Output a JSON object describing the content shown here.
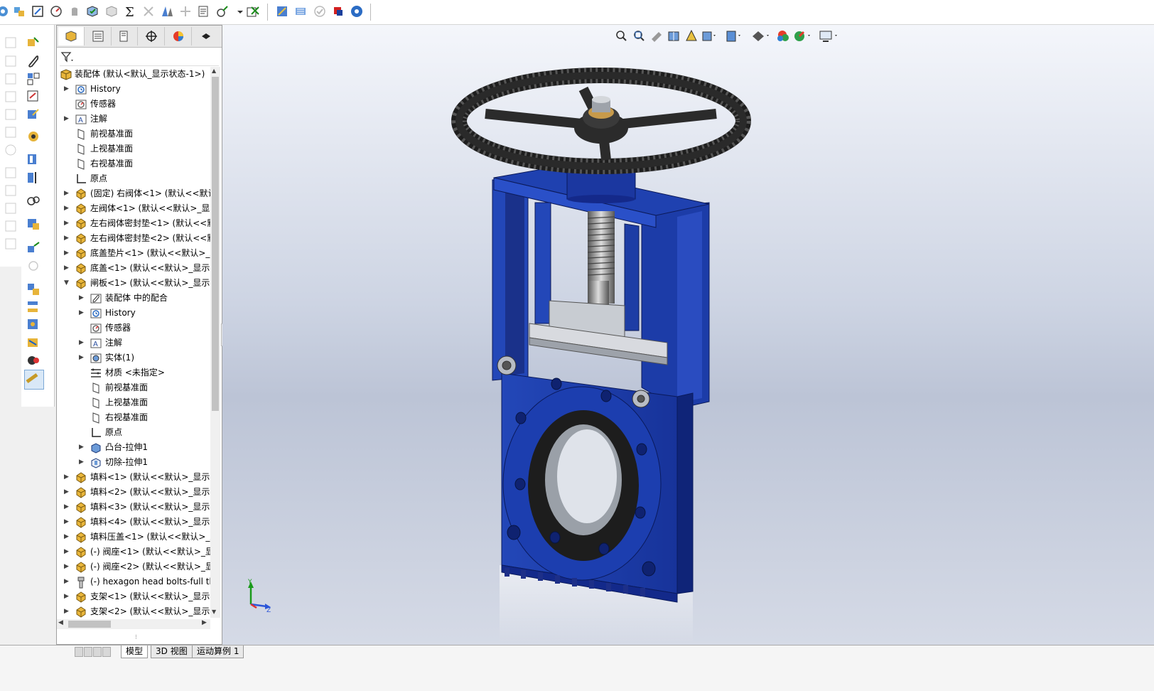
{
  "tree": {
    "root_label": "装配体 (默认<默认_显示状态-1>)",
    "items": [
      {
        "label": "History",
        "level": 1,
        "icon": "history-icon",
        "expand": "collapsed"
      },
      {
        "label": "传感器",
        "level": 1,
        "icon": "sensor-icon",
        "expand": "none"
      },
      {
        "label": "注解",
        "level": 1,
        "icon": "annotation-icon",
        "expand": "collapsed"
      },
      {
        "label": "前视基准面",
        "level": 1,
        "icon": "plane-icon",
        "expand": "none"
      },
      {
        "label": "上视基准面",
        "level": 1,
        "icon": "plane-icon",
        "expand": "none"
      },
      {
        "label": "右视基准面",
        "level": 1,
        "icon": "plane-icon",
        "expand": "none"
      },
      {
        "label": "原点",
        "level": 1,
        "icon": "origin-icon",
        "expand": "none"
      },
      {
        "label": "(固定) 右阀体<1> (默认<<默认>",
        "level": 1,
        "icon": "part-icon",
        "expand": "collapsed"
      },
      {
        "label": "左阀体<1> (默认<<默认>_显示",
        "level": 1,
        "icon": "part-icon",
        "expand": "collapsed"
      },
      {
        "label": "左右阀体密封垫<1> (默认<<默认",
        "level": 1,
        "icon": "part-icon",
        "expand": "collapsed"
      },
      {
        "label": "左右阀体密封垫<2> (默认<<默认",
        "level": 1,
        "icon": "part-icon",
        "expand": "collapsed"
      },
      {
        "label": "底盖垫片<1> (默认<<默认>_显",
        "level": 1,
        "icon": "part-icon",
        "expand": "collapsed"
      },
      {
        "label": "底盖<1> (默认<<默认>_显示状",
        "level": 1,
        "icon": "part-icon",
        "expand": "collapsed"
      },
      {
        "label": "闸板<1> (默认<<默认>_显示状",
        "level": 1,
        "icon": "part-icon",
        "expand": "expanded"
      },
      {
        "label": "装配体 中的配合",
        "level": 2,
        "icon": "mates-icon",
        "expand": "collapsed"
      },
      {
        "label": "History",
        "level": 2,
        "icon": "history-icon",
        "expand": "collapsed"
      },
      {
        "label": "传感器",
        "level": 2,
        "icon": "sensor-icon",
        "expand": "none"
      },
      {
        "label": "注解",
        "level": 2,
        "icon": "annotation-icon",
        "expand": "collapsed"
      },
      {
        "label": "实体(1)",
        "level": 2,
        "icon": "solid-body-icon",
        "expand": "collapsed"
      },
      {
        "label": "材质 <未指定>",
        "level": 2,
        "icon": "material-icon",
        "expand": "none"
      },
      {
        "label": "前视基准面",
        "level": 2,
        "icon": "plane-icon",
        "expand": "none"
      },
      {
        "label": "上视基准面",
        "level": 2,
        "icon": "plane-icon",
        "expand": "none"
      },
      {
        "label": "右视基准面",
        "level": 2,
        "icon": "plane-icon",
        "expand": "none"
      },
      {
        "label": "原点",
        "level": 2,
        "icon": "origin-icon",
        "expand": "none"
      },
      {
        "label": "凸台-拉伸1",
        "level": 2,
        "icon": "extrude-icon",
        "expand": "collapsed"
      },
      {
        "label": "切除-拉伸1",
        "level": 2,
        "icon": "cut-extrude-icon",
        "expand": "collapsed"
      },
      {
        "label": "填料<1> (默认<<默认>_显示状",
        "level": 1,
        "icon": "part-icon",
        "expand": "collapsed"
      },
      {
        "label": "填料<2> (默认<<默认>_显示状",
        "level": 1,
        "icon": "part-icon",
        "expand": "collapsed"
      },
      {
        "label": "填料<3> (默认<<默认>_显示状",
        "level": 1,
        "icon": "part-icon",
        "expand": "collapsed"
      },
      {
        "label": "填料<4> (默认<<默认>_显示状",
        "level": 1,
        "icon": "part-icon",
        "expand": "collapsed"
      },
      {
        "label": "填料压盖<1> (默认<<默认>_显",
        "level": 1,
        "icon": "part-icon",
        "expand": "collapsed"
      },
      {
        "label": "(-) 阀座<1> (默认<<默认>_显示",
        "level": 1,
        "icon": "part-icon",
        "expand": "collapsed"
      },
      {
        "label": "(-) 阀座<2> (默认<<默认>_显示",
        "level": 1,
        "icon": "part-icon",
        "expand": "collapsed"
      },
      {
        "label": "(-) hexagon head bolts-full thr",
        "level": 1,
        "icon": "bolt-icon",
        "expand": "collapsed"
      },
      {
        "label": "支架<1> (默认<<默认>_显示状",
        "level": 1,
        "icon": "part-icon",
        "expand": "collapsed"
      },
      {
        "label": "支架<2> (默认<<默认>_显示状",
        "level": 1,
        "icon": "part-icon",
        "expand": "collapsed"
      }
    ]
  },
  "bottom_tabs": [
    "模型",
    "3D 视图",
    "运动算例 1"
  ],
  "active_tab": "模型",
  "colors": {
    "valve_blue": "#1f3fa8",
    "valve_blue_dark": "#10257a",
    "part_icon": "#e9b63a",
    "handwheel": "#2a2a2a"
  },
  "triad_labels": {
    "y": "Y",
    "z": "Z"
  }
}
